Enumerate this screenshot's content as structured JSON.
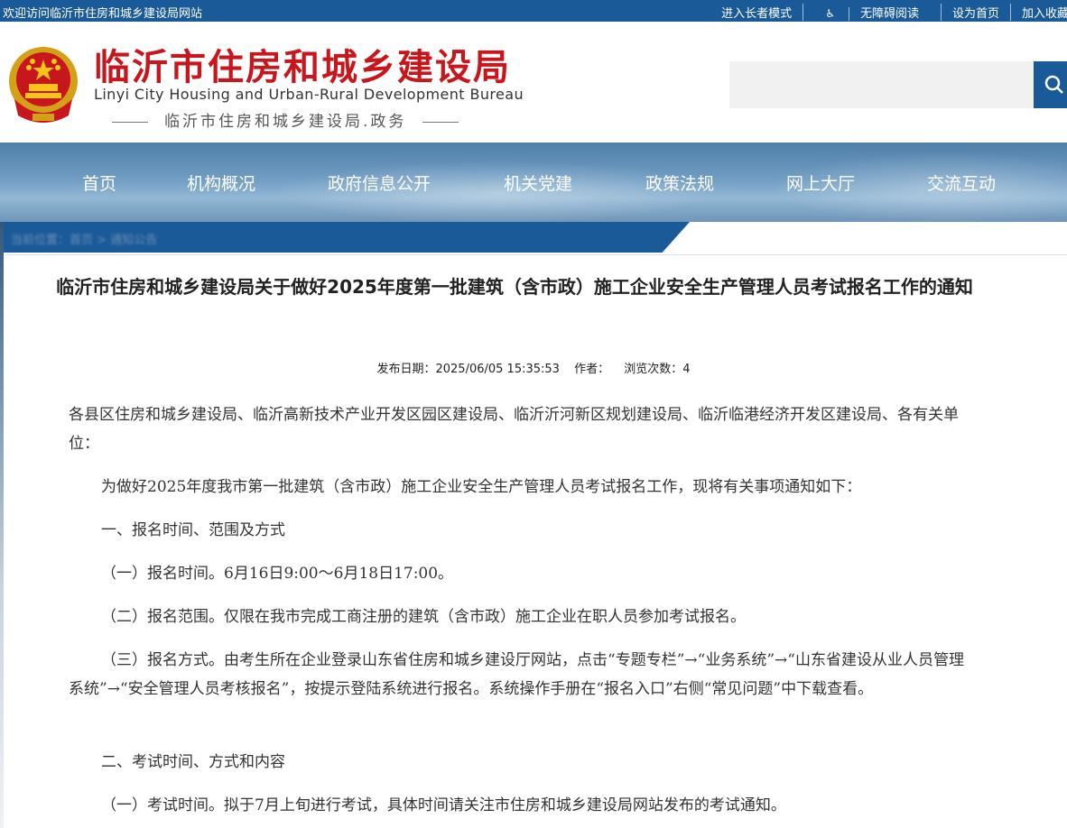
{
  "topbar": {
    "welcome": "欢迎访问临沂市住房和城乡建设局网站",
    "links": [
      "进入长者模式",
      "无障碍阅读",
      "设为首页",
      "加入收藏"
    ]
  },
  "header": {
    "title": "临沂市住房和城乡建设局",
    "title_en": "Linyi City Housing and Urban-Rural Development Bureau",
    "subtitle": "临沂市住房和城乡建设局.政务",
    "search_placeholder": ""
  },
  "nav": [
    "首页",
    "机构概况",
    "政府信息公开",
    "机关党建",
    "政策法规",
    "网上大厅",
    "交流互动"
  ],
  "breadcrumb": "当前位置：首页 > 通知公告",
  "article": {
    "title": "临沂市住房和城乡建设局关于做好2025年度第一批建筑（含市政）施工企业安全生产管理人员考试报名工作的通知",
    "date_label": "发布日期：2025/06/05 15:35:53",
    "author_label": "作者：",
    "views_label": "浏览次数：4",
    "paragraphs": [
      "各县区住房和城乡建设局、临沂高新技术产业开发区园区建设局、临沂沂河新区规划建设局、临沂临港经济开发区建设局、各有关单位：",
      "为做好2025年度我市第一批建筑（含市政）施工企业安全生产管理人员考试报名工作，现将有关事项通知如下：",
      "一、报名时间、范围及方式",
      "（一）报名时间。6月16日9:00～6月18日17:00。",
      "（二）报名范围。仅限在我市完成工商注册的建筑（含市政）施工企业在职人员参加考试报名。",
      "（三）报名方式。由考生所在企业登录山东省住房和城乡建设厅网站，点击“专题专栏”→“业务系统”→“山东省建设从业人员管理系统”→“安全管理人员考核报名”，按提示登陆系统进行报名。系统操作手册在“报名入口”右侧“常见问题”中下载查看。",
      "二、考试时间、方式和内容",
      "（一）考试时间。拟于7月上旬进行考试，具体时间请关注市住房和城乡建设局网站发布的考试通知。"
    ]
  },
  "colors": {
    "brand_blue": "#1b5a98",
    "title_red": "#c8161d"
  }
}
